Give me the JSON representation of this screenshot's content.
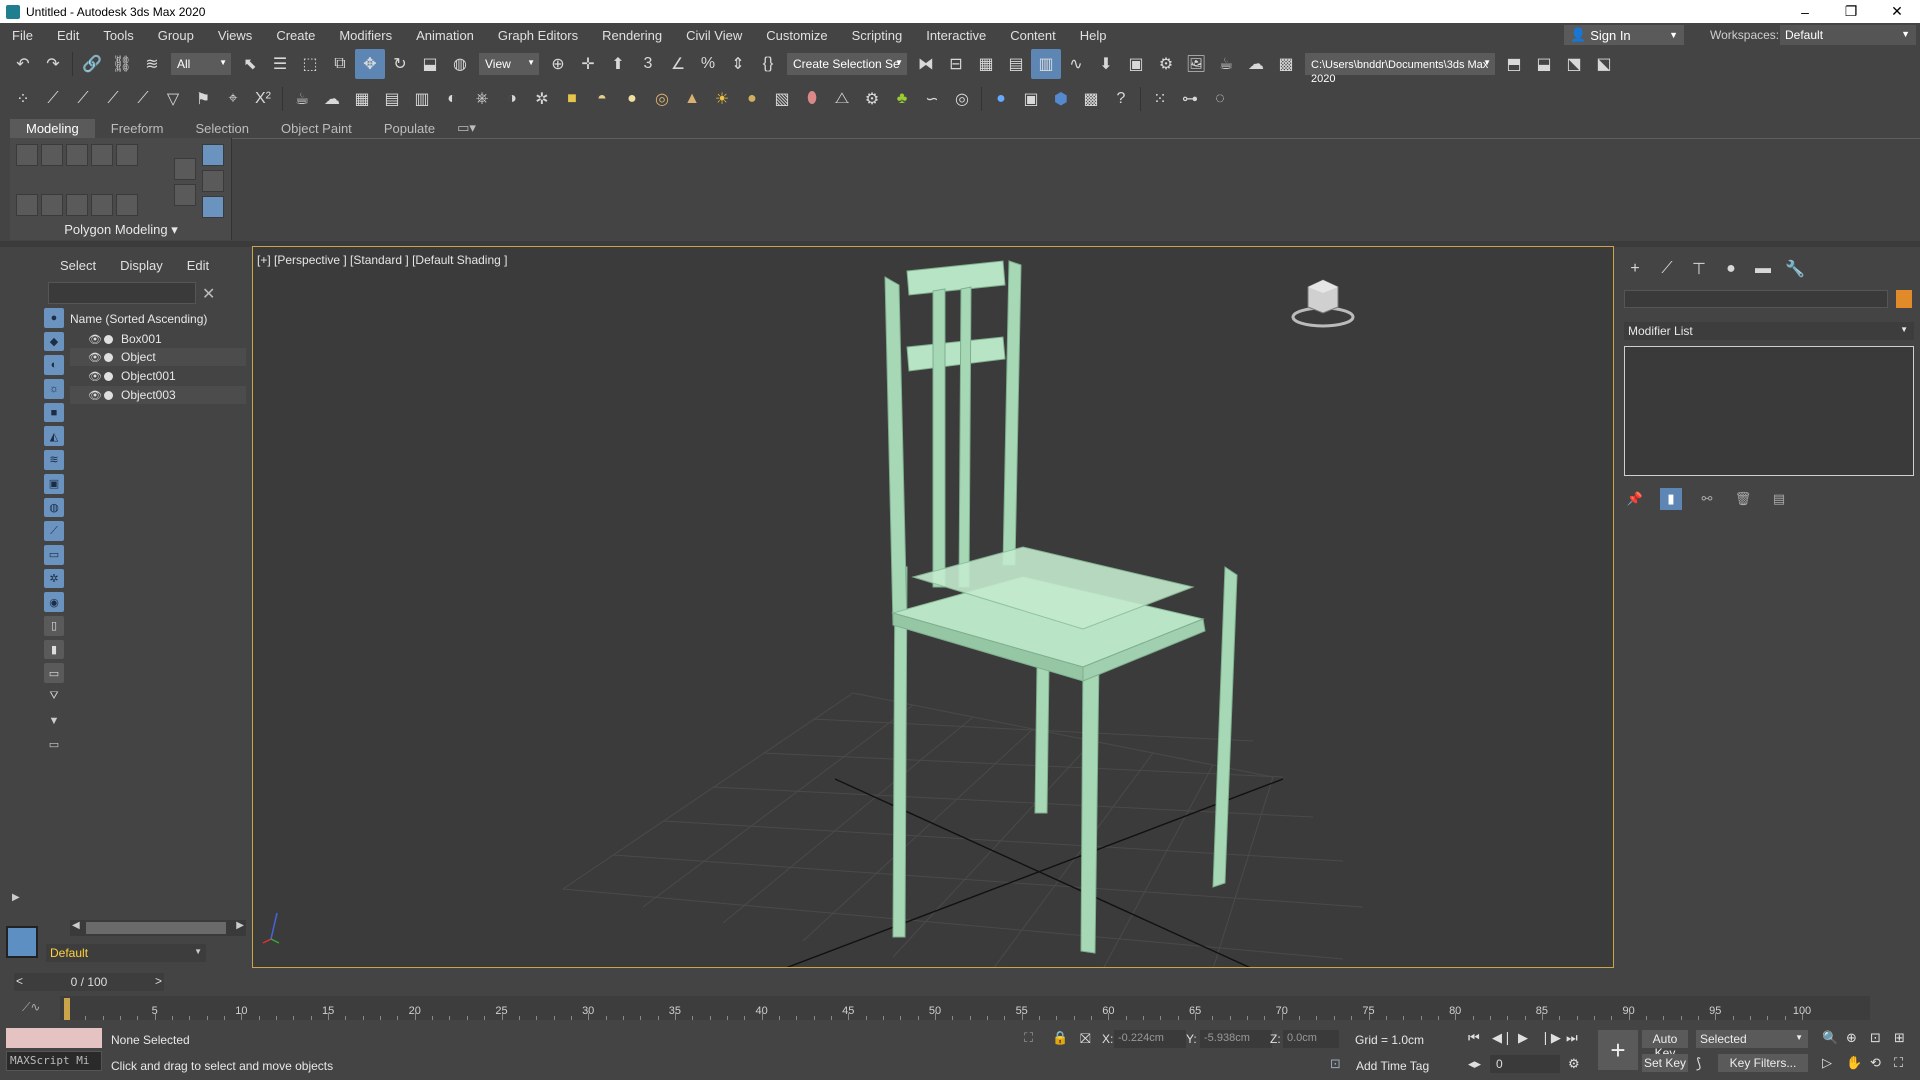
{
  "window": {
    "title": "Untitled - Autodesk 3ds Max 2020",
    "minimize": "–",
    "maximize": "❐",
    "close": "✕"
  },
  "menu": [
    "File",
    "Edit",
    "Tools",
    "Group",
    "Views",
    "Create",
    "Modifiers",
    "Animation",
    "Graph Editors",
    "Rendering",
    "Civil View",
    "Customize",
    "Scripting",
    "Interactive",
    "Content",
    "Help"
  ],
  "account": {
    "sign_in": "Sign In",
    "workspaces_label": "Workspaces:",
    "workspace": "Default"
  },
  "toolbar1": {
    "filter": "All",
    "ref_coord": "View",
    "selection_set": "Create Selection Se",
    "project_path": "C:\\Users\\bnddr\\Documents\\3ds Max 2020"
  },
  "ribbon": {
    "tabs": [
      "Modeling",
      "Freeform",
      "Selection",
      "Object Paint",
      "Populate"
    ],
    "active_tab": "Modeling",
    "panel_label": "Polygon Modeling ▾"
  },
  "scene_explorer": {
    "tabs": [
      "Select",
      "Display",
      "Edit"
    ],
    "column_header": "Name (Sorted Ascending)",
    "items": [
      "Box001",
      "Object",
      "Object001",
      "Object003"
    ],
    "layer": "Default"
  },
  "viewport": {
    "label": "[+] [Perspective ] [Standard ] [Default Shading ]",
    "chair_color": "#a6d8b6"
  },
  "command_panel": {
    "modifier_list": "Modifier List",
    "object_color": "#e08a2a"
  },
  "timeline": {
    "position": "0 / 100",
    "ticks": [
      5,
      10,
      15,
      20,
      25,
      30,
      35,
      40,
      45,
      50,
      55,
      60,
      65,
      70,
      75,
      80,
      85,
      90,
      95,
      100
    ]
  },
  "status": {
    "maxscript_placeholder": "MAXScript Mi",
    "selection": "None Selected",
    "prompt": "Click and drag to select and move objects",
    "x_label": "X:",
    "x_value": "-0.224cm",
    "y_label": "Y:",
    "y_value": "-5.938cm",
    "z_label": "Z:",
    "z_value": "0.0cm",
    "grid": "Grid = 1.0cm",
    "add_time_tag": "Add Time Tag",
    "frame": "0",
    "auto_key": "Auto Key",
    "key_mode": "Selected",
    "set_key": "Set Key",
    "key_filters": "Key Filters..."
  }
}
